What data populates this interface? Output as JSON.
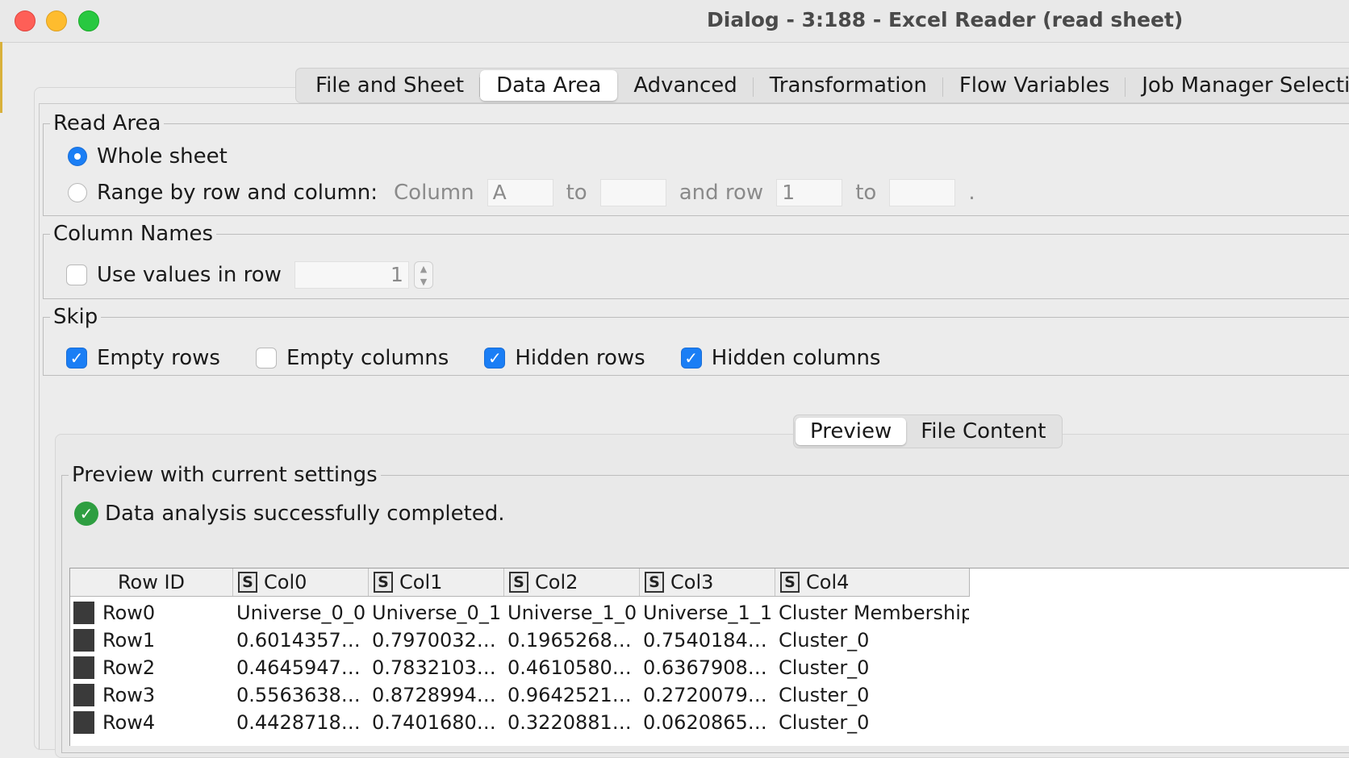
{
  "window": {
    "title": "Dialog - 3:188 - Excel Reader (read sheet)"
  },
  "tabs": [
    {
      "label": "File and Sheet",
      "active": false
    },
    {
      "label": "Data Area",
      "active": true
    },
    {
      "label": "Advanced",
      "active": false
    },
    {
      "label": "Transformation",
      "active": false
    },
    {
      "label": "Flow Variables",
      "active": false
    },
    {
      "label": "Job Manager Selection",
      "active": false
    }
  ],
  "read_area": {
    "legend": "Read Area",
    "whole_sheet_label": "Whole sheet",
    "whole_sheet_selected": true,
    "range_label": "Range by row and column:",
    "range_selected": false,
    "column_label": "Column",
    "column_from": "A",
    "column_to_label": "to",
    "column_to": "",
    "row_label": "and row",
    "row_from": "1",
    "row_to_label": "to",
    "row_to": "",
    "trailing_period": "."
  },
  "column_names": {
    "legend": "Column Names",
    "use_values_label": "Use values in row",
    "use_values_checked": false,
    "row_value": "1"
  },
  "skip": {
    "legend": "Skip",
    "options": [
      {
        "label": "Empty rows",
        "checked": true
      },
      {
        "label": "Empty columns",
        "checked": false
      },
      {
        "label": "Hidden rows",
        "checked": true
      },
      {
        "label": "Hidden columns",
        "checked": true
      }
    ]
  },
  "preview_tabs": [
    {
      "label": "Preview",
      "active": true
    },
    {
      "label": "File Content",
      "active": false
    }
  ],
  "preview": {
    "legend": "Preview with current settings",
    "status": "Data analysis successfully completed."
  },
  "table": {
    "row_id_header": "Row ID",
    "type_badge": "S",
    "columns": [
      "Col0",
      "Col1",
      "Col2",
      "Col3",
      "Col4"
    ],
    "rows": [
      {
        "id": "Row0",
        "cells": [
          "Universe_0_0",
          "Universe_0_1",
          "Universe_1_0",
          "Universe_1_1",
          "Cluster Membership"
        ]
      },
      {
        "id": "Row1",
        "cells": [
          "0.6014357…",
          "0.7970032…",
          "0.1965268…",
          "0.7540184…",
          "Cluster_0"
        ]
      },
      {
        "id": "Row2",
        "cells": [
          "0.4645947…",
          "0.7832103…",
          "0.4610580…",
          "0.6367908…",
          "Cluster_0"
        ]
      },
      {
        "id": "Row3",
        "cells": [
          "0.5563638…",
          "0.8728994…",
          "0.9642521…",
          "0.2720079…",
          "Cluster_0"
        ]
      },
      {
        "id": "Row4",
        "cells": [
          "0.4428718…",
          "0.7401680…",
          "0.3220881…",
          "0.0620865…",
          "Cluster_0"
        ]
      }
    ]
  },
  "colors": {
    "accent": "#1a7ef5",
    "success": "#2e9e41"
  }
}
